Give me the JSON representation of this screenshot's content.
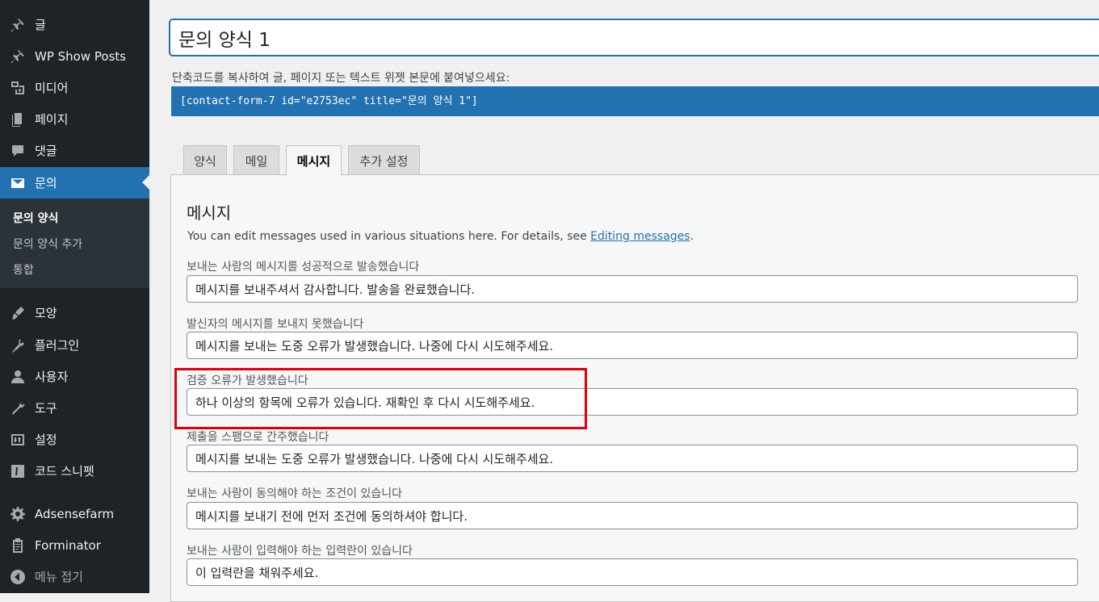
{
  "sidebar": {
    "items": [
      {
        "label": "글",
        "icon": "pin-icon"
      },
      {
        "label": "WP Show Posts",
        "icon": "pin-icon"
      },
      {
        "label": "미디어",
        "icon": "media-icon"
      },
      {
        "label": "페이지",
        "icon": "pages-icon"
      },
      {
        "label": "댓글",
        "icon": "comments-icon"
      },
      {
        "label": "문의",
        "icon": "mail-icon",
        "active": true
      },
      {
        "label": "모양",
        "icon": "appearance-icon"
      },
      {
        "label": "플러그인",
        "icon": "plugins-icon"
      },
      {
        "label": "사용자",
        "icon": "users-icon"
      },
      {
        "label": "도구",
        "icon": "tools-icon"
      },
      {
        "label": "설정",
        "icon": "settings-icon"
      },
      {
        "label": "코드 스니펫",
        "icon": "code-snippets-icon"
      },
      {
        "label": "Adsensefarm",
        "icon": "gear-icon"
      },
      {
        "label": "Forminator",
        "icon": "clipboard-icon"
      },
      {
        "label": "메뉴 접기",
        "icon": "collapse-icon"
      }
    ],
    "submenu": [
      {
        "label": "문의 양식",
        "current": true
      },
      {
        "label": "문의 양식 추가"
      },
      {
        "label": "통합"
      }
    ]
  },
  "form": {
    "title": "문의 양식 1",
    "shortcode_hint": "단축코드를 복사하여 글, 페이지 또는 텍스트 위젯 본문에 붙여넣으세요:",
    "shortcode": "[contact-form-7 id=\"e2753ec\" title=\"문의 양식 1\"]"
  },
  "tabs": [
    {
      "label": "양식"
    },
    {
      "label": "메일"
    },
    {
      "label": "메시지",
      "active": true
    },
    {
      "label": "추가 설정"
    }
  ],
  "panel": {
    "heading": "메시지",
    "desc_prefix": "You can edit messages used in various situations here. For details, see ",
    "desc_link": "Editing messages",
    "desc_suffix": ".",
    "fields": [
      {
        "label": "보내는 사람의 메시지를 성공적으로 발송했습니다",
        "value": "메시지를 보내주셔서 감사합니다. 발송을 완료했습니다."
      },
      {
        "label": "발신자의 메시지를 보내지 못했습니다",
        "value": "메시지를 보내는 도중 오류가 발생했습니다. 나중에 다시 시도해주세요."
      },
      {
        "label": "검증 오류가 발생했습니다",
        "value": "하나 이상의 항목에 오류가 있습니다. 재확인 후 다시 시도해주세요."
      },
      {
        "label": "제출을 스팸으로 간주했습니다",
        "value": "메시지를 보내는 도중 오류가 발생했습니다. 나중에 다시 시도해주세요."
      },
      {
        "label": "보내는 사람이 동의해야 하는 조건이 있습니다",
        "value": "메시지를 보내기 전에 먼저 조건에 동의하셔야 합니다."
      },
      {
        "label": "보내는 사람이 입력해야 하는 입력란이 있습니다",
        "value": "이 입력란을 채워주세요."
      }
    ]
  },
  "colors": {
    "sidebar_bg": "#1d2327",
    "accent": "#2271b1",
    "highlight": "#e0000a"
  }
}
